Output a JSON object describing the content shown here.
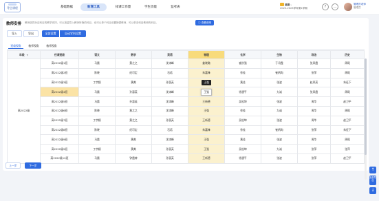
{
  "app": {
    "logo_text": "寻企课程",
    "nav": [
      "基础数据",
      "新增工具",
      "排课工作量",
      "学生功能",
      "监考表"
    ],
    "active_nav": 1,
    "term": {
      "badge": "选择",
      "current": "2022-2023学年第1学期",
      "chevron": "v"
    },
    "user": {
      "name": "管理员老师",
      "role": "管理员"
    },
    "icons": {
      "help": "?",
      "message": "…"
    }
  },
  "page": {
    "title": "教师安排",
    "description": "教师选择对应科目的教学安排，可以批量导入教师所授的科目，也可以单个科目设置授课教师，可以单击科目教师的科目。",
    "preview_button": "查看说明",
    "actions": {
      "import": "导入",
      "export": "导出",
      "all_settings": "全部设置",
      "copy_settings": "自动学科设置"
    },
    "subtabs": [
      "班级视角",
      "教师视角",
      "教师视角"
    ],
    "active_subtab": 0
  },
  "table": {
    "headers": [
      "年级",
      "任课班级",
      "语文",
      "数学",
      "英语",
      "物理",
      "化学",
      "生物",
      "政治",
      "历史"
    ],
    "grade_filter_icon": "▼",
    "grade": "高2022级",
    "highlight_column": 5,
    "selected_row": 3,
    "edit_box": {
      "row": 3,
      "text": "王强"
    },
    "tooltip": {
      "row": 2,
      "text": "王强"
    },
    "rows": [
      [
        "高2022级1班",
        "马晨",
        "黄之之",
        "沈涛峰",
        "姜晓璐",
        "崔阶强",
        "于讯霞",
        "张凤霞",
        "周曦"
      ],
      [
        "高2022级2班",
        "陈晓",
        "纪可定",
        "石诺",
        "朱嘉锋",
        "徐桂",
        "崔帆昀",
        "张萍",
        "周曦"
      ],
      [
        "高2022级3班",
        "丁宗颖",
        "黄美",
        "孙惠英",
        "王强",
        "黄佳",
        "张波",
        "赵凤亮",
        "朱征下"
      ],
      [
        "高2022级4班",
        "马晨",
        "孙惠英",
        "沈涛峰",
        "王强",
        "徐建平",
        "九诚",
        "张凤霞",
        "周曦"
      ],
      [
        "高2022级5班",
        "马晨",
        "孙惠英",
        "沈涛峰",
        "王新德",
        "吴松坤",
        "张波",
        "周华",
        "赵卫平"
      ],
      [
        "高2022级6班",
        "陈晓",
        "黄之之",
        "沈涛峰",
        "王强",
        "徐桂",
        "九诚",
        "周华",
        "周曦"
      ],
      [
        "高2022级7班",
        "丁宗颖",
        "黄之之",
        "孙惠英",
        "王新德",
        "吴松坤",
        "张波",
        "周华",
        "赵卫平"
      ],
      [
        "高2022级8班",
        "陈晓",
        "纪可定",
        "石诺",
        "朱嘉锋",
        "徐桂",
        "崔帆昀",
        "张萍",
        "朱征下"
      ],
      [
        "高2022级9班",
        "马晨",
        "黄美",
        "沈涛峰",
        "王强",
        "黄佳",
        "张波",
        "周华",
        "周曦"
      ],
      [
        "高2022级9班",
        "丁宗颖",
        "黄美",
        "孙惠英",
        "王强",
        "吴松坤",
        "九诚",
        "张萍",
        "张萍"
      ],
      [
        "高2022级10班",
        "马晨",
        "钟霞婷",
        "孙惠英",
        "王新德",
        "徐建平",
        "张波",
        "张萍",
        "赵卫平"
      ]
    ]
  },
  "footer": {
    "prev": "上一步",
    "next": "下一步"
  },
  "float_tools": {
    "top": "↑",
    "export_label": "批量导出",
    "download": "↓"
  },
  "colors": {
    "primary": "#2f6be0",
    "highlight": "#f8db7c",
    "selected": "#fbe3a5"
  }
}
